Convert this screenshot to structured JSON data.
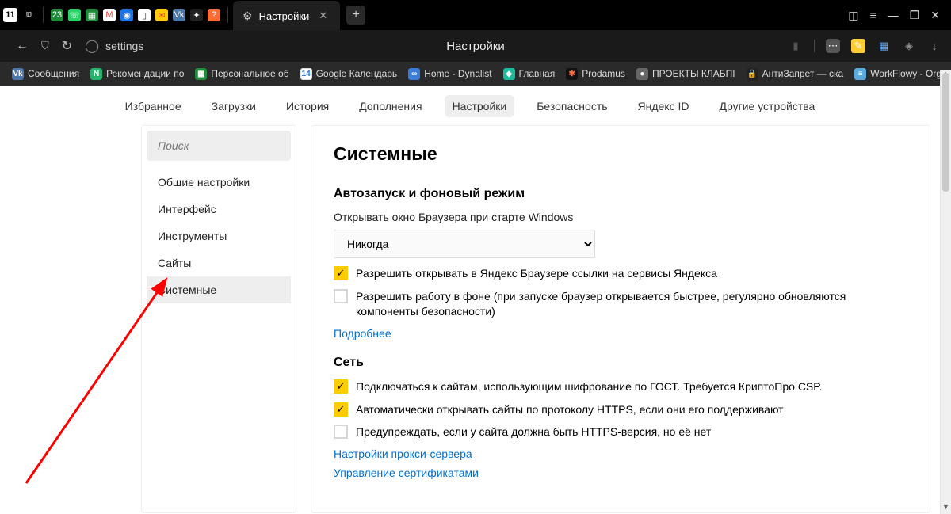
{
  "titlebar": {
    "badge": "11",
    "active_tab": "Настройки",
    "gear_icon": "gear"
  },
  "navbar": {
    "url": "settings",
    "title": "Настройки"
  },
  "bookmarks": [
    {
      "label": "Сообщения",
      "bg": "#4a76a8",
      "fg": "#fff",
      "letter": "Vk"
    },
    {
      "label": "Рекомендации по",
      "bg": "#25b36c",
      "fg": "#fff",
      "letter": "N"
    },
    {
      "label": "Персональное об",
      "bg": "#1f8c3b",
      "fg": "#fff",
      "letter": "≡"
    },
    {
      "label": "Google Календарь",
      "bg": "#fff",
      "fg": "#1a73e8",
      "letter": "14"
    },
    {
      "label": "Home - Dynalist",
      "bg": "#3a7bd5",
      "fg": "#fff",
      "letter": "∞"
    },
    {
      "label": "Главная",
      "bg": "#1abc9c",
      "fg": "#fff",
      "letter": "◆"
    },
    {
      "label": "Prodamus",
      "bg": "#111",
      "fg": "#ff5252",
      "letter": "✱"
    },
    {
      "label": "ПРОЕКТЫ КЛАБПI",
      "bg": "#444",
      "fg": "#fff",
      "letter": "●"
    },
    {
      "label": "АнтиЗапрет — ска",
      "bg": "#222",
      "fg": "#fff",
      "letter": "🔒"
    },
    {
      "label": "WorkFlowy - Orga",
      "bg": "#5ca9dd",
      "fg": "#fff",
      "letter": "≡"
    }
  ],
  "settings_tabs": [
    "Избранное",
    "Загрузки",
    "История",
    "Дополнения",
    "Настройки",
    "Безопасность",
    "Яндекс ID",
    "Другие устройства"
  ],
  "active_settings_tab": 4,
  "sidebar": {
    "search_placeholder": "Поиск",
    "items": [
      "Общие настройки",
      "Интерфейс",
      "Инструменты",
      "Сайты",
      "Системные"
    ],
    "active": 4
  },
  "pane": {
    "heading": "Системные",
    "section1": {
      "title": "Автозапуск и фоновый режим",
      "sub": "Открывать окно Браузера при старте Windows",
      "select_value": "Никогда",
      "cb1_label": "Разрешить открывать в Яндекс Браузере ссылки на сервисы Яндекса",
      "cb1": true,
      "cb2_label": "Разрешить работу в фоне (при запуске браузер открывается быстрее, регулярно обновляются компоненты безопасности)",
      "cb2": false,
      "more": "Подробнее"
    },
    "section2": {
      "title": "Сеть",
      "cb1_label": "Подключаться к сайтам, использующим шифрование по ГОСТ. Требуется КриптоПро CSP.",
      "cb1": true,
      "cb2_label": "Автоматически открывать сайты по протоколу HTTPS, если они его поддерживают",
      "cb2": true,
      "cb3_label": "Предупреждать, если у сайта должна быть HTTPS-версия, но её нет",
      "cb3": false,
      "link1": "Настройки прокси-сервера",
      "link2": "Управление сертификатами"
    }
  }
}
